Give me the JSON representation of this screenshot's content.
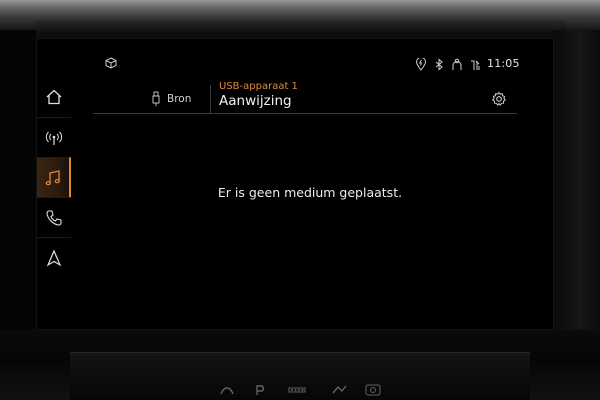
{
  "statusbar": {
    "time": "11:05",
    "icons": [
      "cube-icon",
      "location-bolt-icon",
      "bluetooth-icon",
      "person-icon",
      "signal-icon"
    ]
  },
  "header": {
    "source_label": "Bron",
    "subtitle": "USB-apparaat 1",
    "title": "Aanwijzing"
  },
  "nav": {
    "items": [
      {
        "name": "home",
        "icon": "home-icon",
        "active": false
      },
      {
        "name": "radio",
        "icon": "radio-antenna-icon",
        "active": false
      },
      {
        "name": "media",
        "icon": "music-note-icon",
        "active": true
      },
      {
        "name": "phone",
        "icon": "phone-icon",
        "active": false
      },
      {
        "name": "navigation",
        "icon": "navigation-arrow-icon",
        "active": false
      }
    ]
  },
  "main": {
    "message": "Er is geen medium geplaatst."
  },
  "colors": {
    "accent": "#e08a3a",
    "background": "#000000",
    "text": "#ededed"
  }
}
